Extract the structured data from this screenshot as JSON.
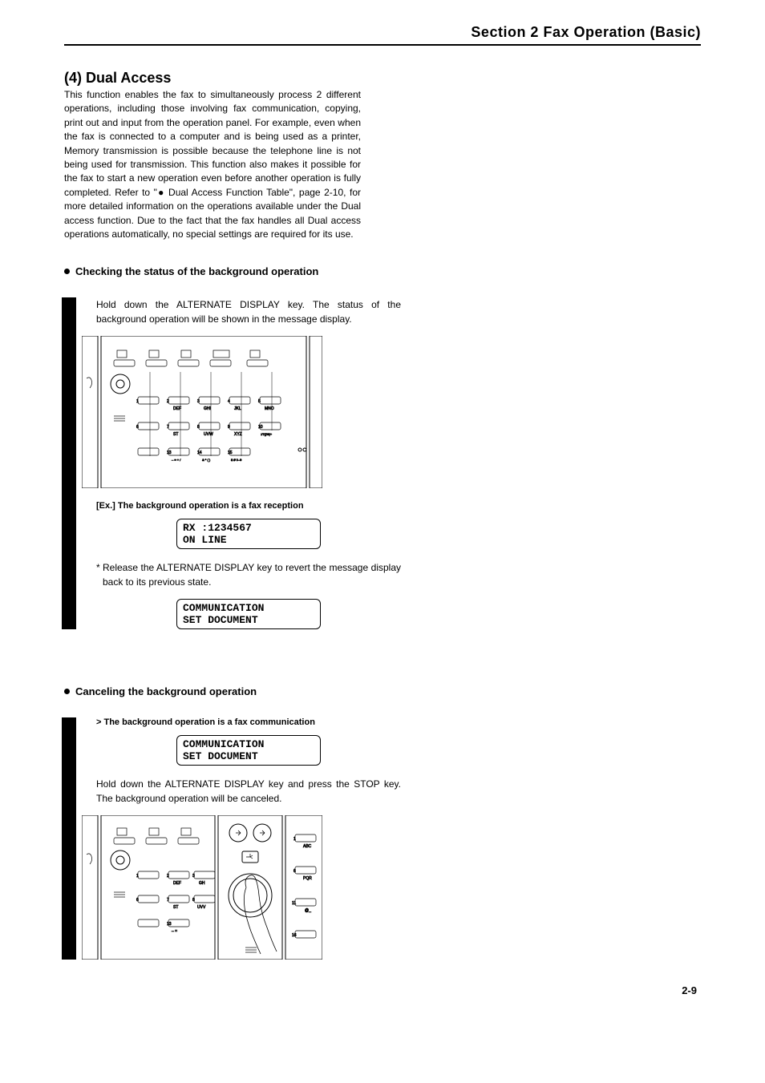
{
  "header": {
    "section": "Section 2   Fax Operation (Basic)"
  },
  "sub": {
    "title": "(4) Dual Access",
    "para": "This function enables the fax to simultaneously process 2 different operations, including those involving fax communication, copying, print out and input from the operation panel. For example, even when the fax is connected to a computer and is being used as a printer, Memory transmission is possible because the telephone line is not being used for transmission. This function also makes it possible for the fax to start a new operation even before another operation is fully completed. Refer to \"● Dual Access Function Table\", page 2-10, for more detailed information on the operations available under the Dual access function. Due to the fact that the fax handles all Dual access operations automatically, no special settings are required for its use."
  },
  "check": {
    "heading": "Checking the status of the background operation",
    "step": "Hold down the ALTERNATE DISPLAY key. The status of the background operation will be shown in the message display.",
    "exlabel": "[Ex.] The background operation is a fax reception",
    "lcd1_l1": "RX :1234567",
    "lcd1_l2": "ON LINE",
    "note": "Release the ALTERNATE DISPLAY key to revert the message display back to its previous state.",
    "lcd2_l1": "COMMUNICATION",
    "lcd2_l2": "SET DOCUMENT"
  },
  "cancel": {
    "heading": "Canceling the background operation",
    "subhead": "> The background operation is a fax communication",
    "lcd_l1": "COMMUNICATION",
    "lcd_l2": "SET DOCUMENT",
    "step": "Hold down the ALTERNATE DISPLAY key and press the STOP key. The background operation will be canceled."
  },
  "panel_labels": {
    "row1": [
      "DEF",
      "GHI",
      "JKL",
      "MNO"
    ],
    "row2": [
      "ST",
      "UVW",
      "XYZ",
      ":/?{}%|+"
    ],
    "row3": [
      "– = + /",
      "& * ( )",
      "$ # 0–9"
    ]
  },
  "pagenum": "2-9"
}
